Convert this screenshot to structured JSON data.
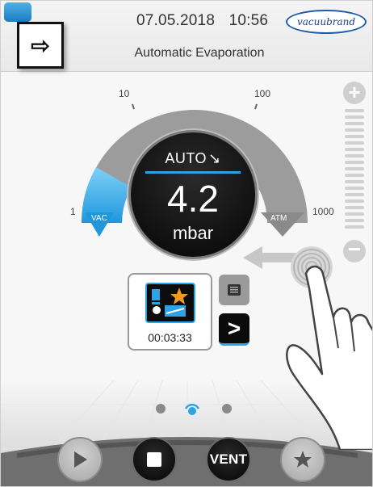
{
  "header": {
    "date": "07.05.2018",
    "time": "10:56",
    "brand": "vacuubrand",
    "title": "Automatic Evaporation"
  },
  "gauge": {
    "scale_labels": [
      "1",
      "10",
      "100",
      "1000"
    ],
    "vac_label": "VAC",
    "atm_label": "ATM",
    "mode": "AUTO",
    "mode_arrow": "↘",
    "value": "4.2",
    "unit": "mbar"
  },
  "program": {
    "elapsed": "00:03:33",
    "icon": "evaporation-program-icon"
  },
  "controls": {
    "vent_label": "VENT",
    "buttons": [
      "play",
      "stop",
      "vent",
      "favorite"
    ]
  },
  "pager": {
    "pages": 3,
    "active": 2
  },
  "colors": {
    "accent": "#2ea3e3",
    "gauge_grey": "#9b9b9b",
    "dark": "#0b0b0b"
  }
}
